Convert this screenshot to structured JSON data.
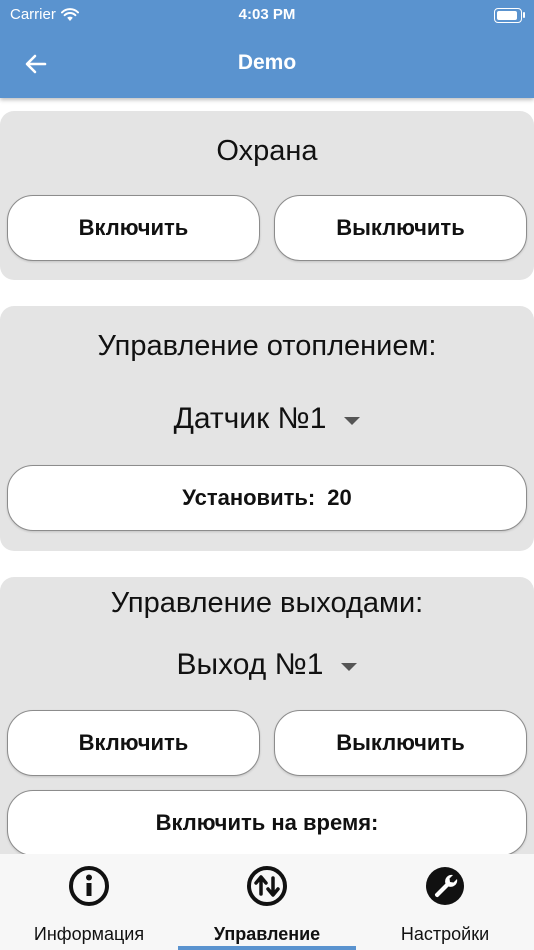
{
  "status_bar": {
    "carrier": "Carrier",
    "time": "4:03 PM",
    "battery_level": 0.9
  },
  "header": {
    "title": "Demo"
  },
  "guard": {
    "title": "Охрана",
    "on_label": "Включить",
    "off_label": "Выключить"
  },
  "heating": {
    "title": "Управление отоплением:",
    "sensor_selected": "Датчик №1",
    "set_label": "Установить:",
    "set_value": "20"
  },
  "outputs": {
    "title": "Управление выходами:",
    "output_selected": "Выход №1",
    "on_label": "Включить",
    "off_label": "Выключить",
    "timed_label": "Включить на время:"
  },
  "bottom_nav": {
    "items": [
      {
        "label": "Информация",
        "icon": "info-icon"
      },
      {
        "label": "Управление",
        "icon": "swap-vertical-icon"
      },
      {
        "label": "Настройки",
        "icon": "wrench-icon"
      }
    ],
    "active_index": 1
  },
  "colors": {
    "accent": "#5a93cf",
    "card": "#e4e4e4",
    "nav_background": "#f7f7f7"
  }
}
